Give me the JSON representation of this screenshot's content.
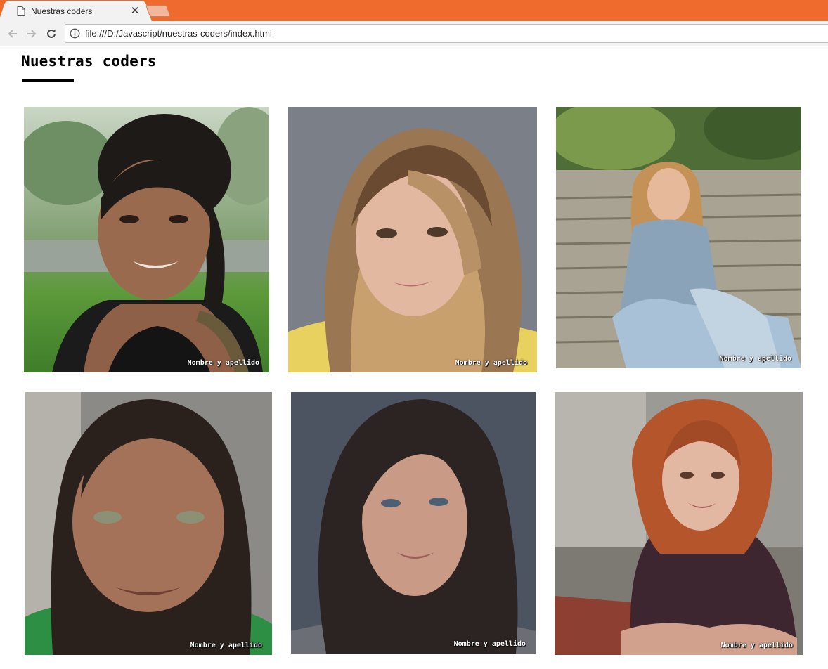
{
  "browser": {
    "tab_title": "Nuestras coders",
    "tab_close": "✕",
    "url": "file:///D:/Javascript/nuestras-coders/index.html",
    "accent_color": "#ee6b2d"
  },
  "page": {
    "heading": "Nuestras coders",
    "coders": [
      {
        "caption": "Nombre y apellido",
        "photo_icon": "portrait-photo-1"
      },
      {
        "caption": "Nombre y apellido",
        "photo_icon": "portrait-photo-2"
      },
      {
        "caption": "Nombre y apellido",
        "photo_icon": "portrait-photo-3"
      },
      {
        "caption": "Nombre y apellido",
        "photo_icon": "portrait-photo-4"
      },
      {
        "caption": "Nombre y apellido",
        "photo_icon": "portrait-photo-5"
      },
      {
        "caption": "Nombre y apellido",
        "photo_icon": "portrait-photo-6"
      }
    ]
  }
}
